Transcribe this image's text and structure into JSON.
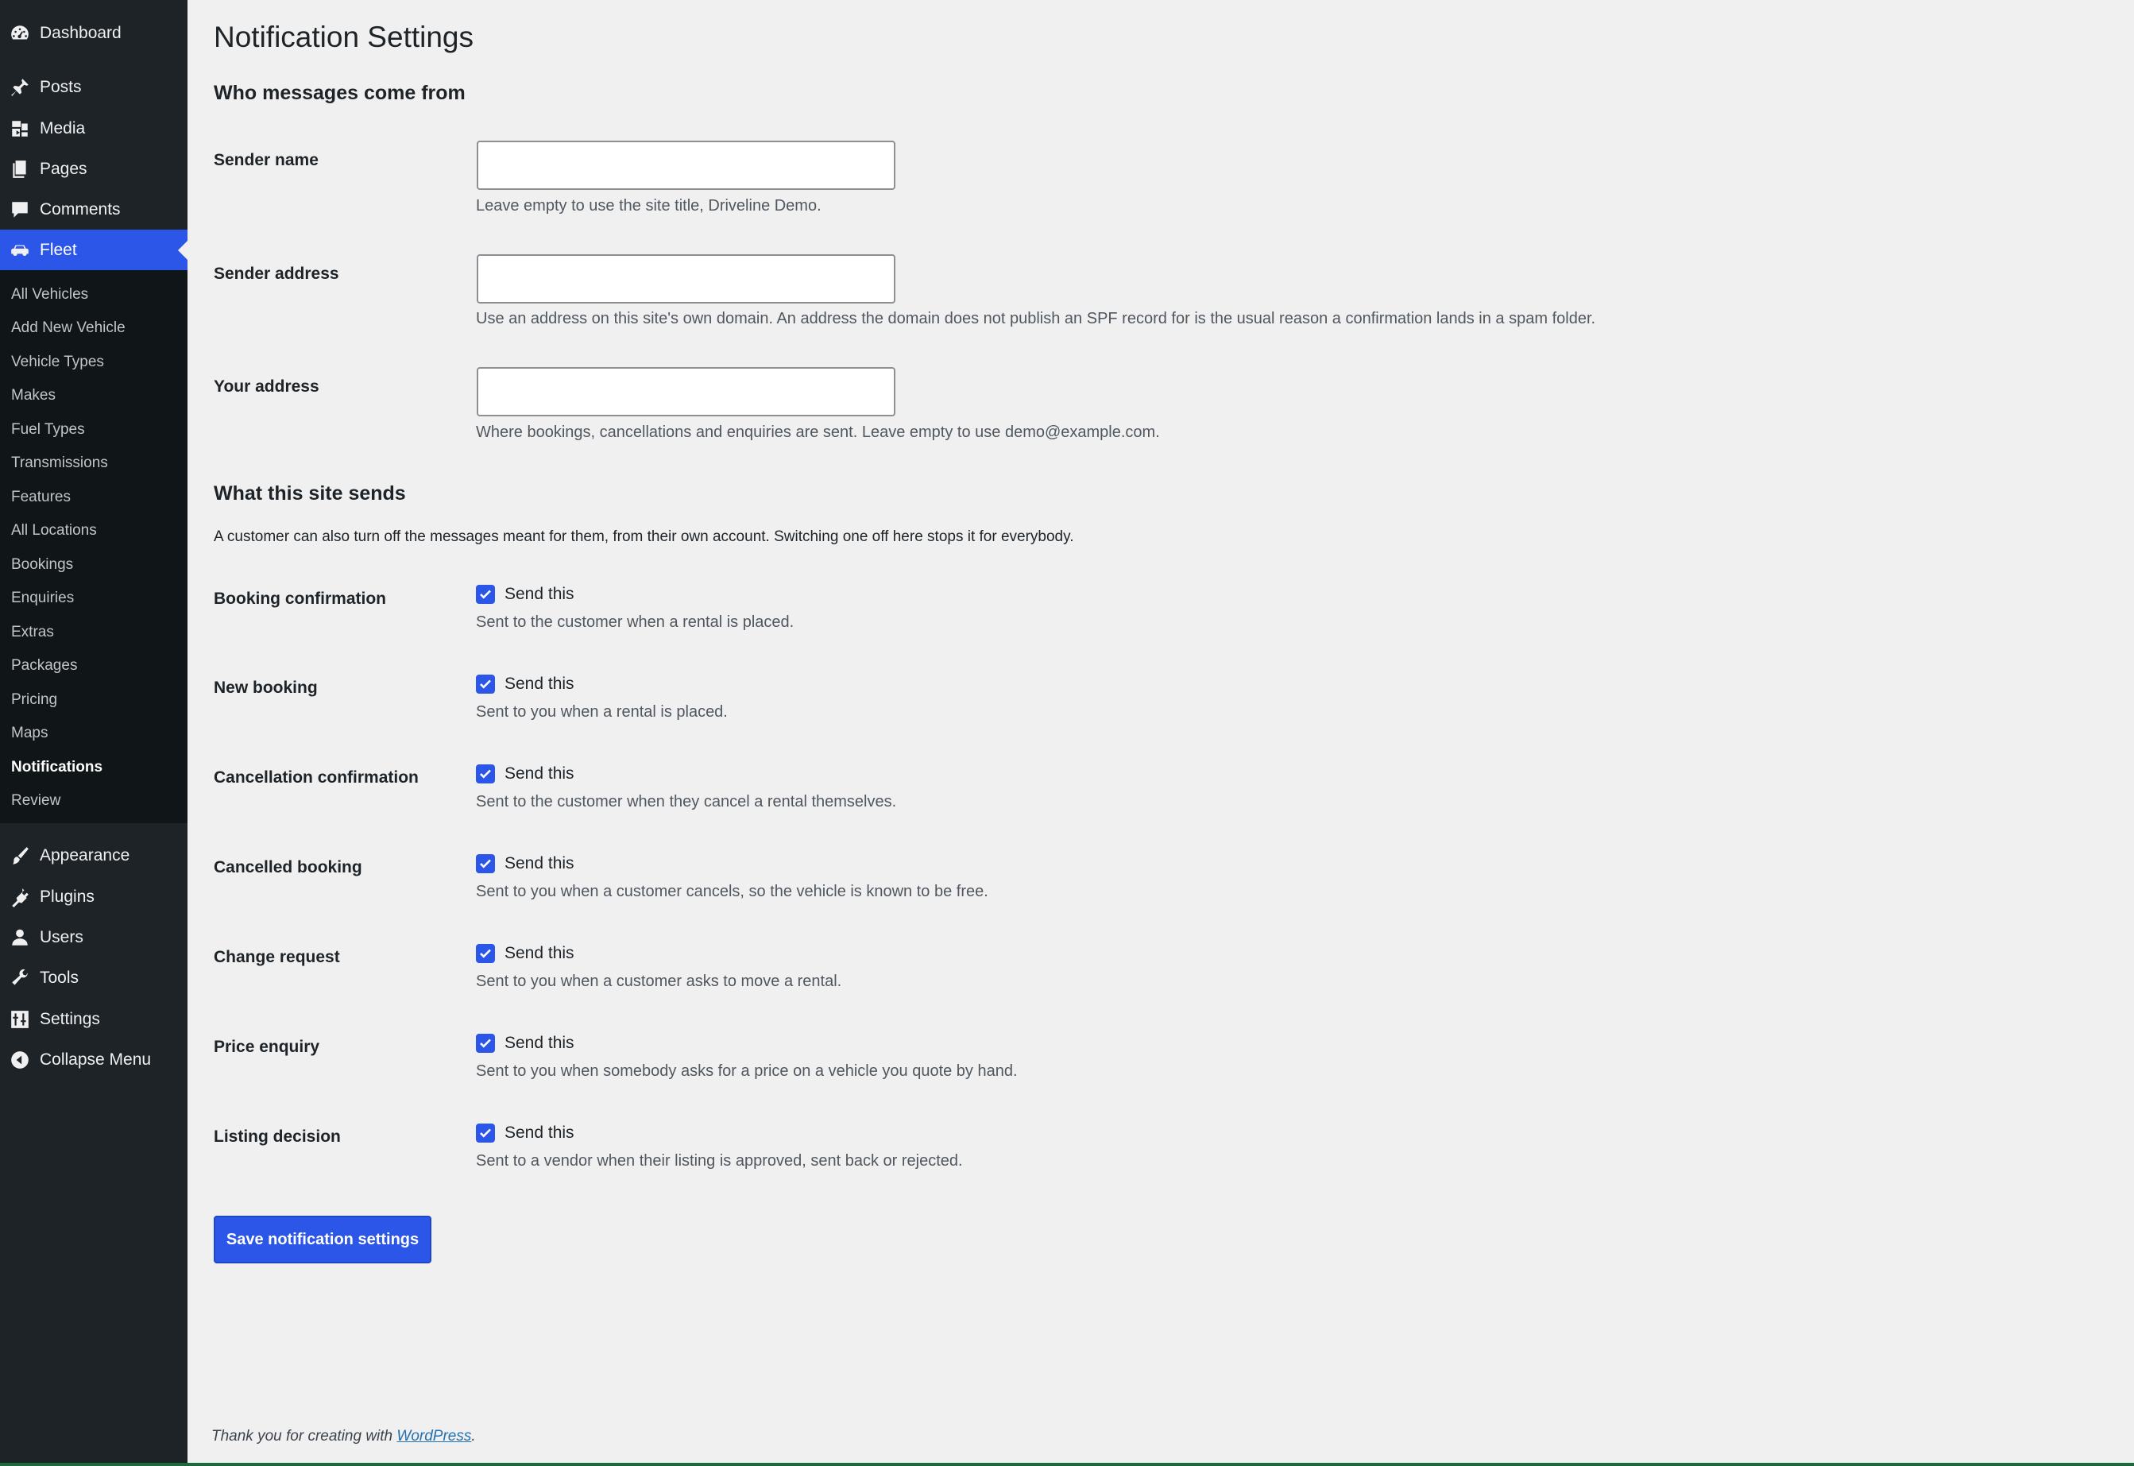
{
  "sidebar": {
    "top": [
      {
        "label": "Dashboard",
        "icon": "dashboard-icon"
      }
    ],
    "items": [
      {
        "label": "Posts",
        "icon": "pin-icon"
      },
      {
        "label": "Media",
        "icon": "media-icon"
      },
      {
        "label": "Pages",
        "icon": "pages-icon"
      },
      {
        "label": "Comments",
        "icon": "comment-icon"
      },
      {
        "label": "Fleet",
        "icon": "car-icon",
        "active": true
      }
    ],
    "submenu": [
      "All Vehicles",
      "Add New Vehicle",
      "Vehicle Types",
      "Makes",
      "Fuel Types",
      "Transmissions",
      "Features",
      "All Locations",
      "Bookings",
      "Enquiries",
      "Extras",
      "Packages",
      "Pricing",
      "Maps",
      "Notifications",
      "Review"
    ],
    "submenu_current": "Notifications",
    "bottom": [
      {
        "label": "Appearance",
        "icon": "brush-icon"
      },
      {
        "label": "Plugins",
        "icon": "plug-icon"
      },
      {
        "label": "Users",
        "icon": "user-icon"
      },
      {
        "label": "Tools",
        "icon": "wrench-icon"
      },
      {
        "label": "Settings",
        "icon": "settings-icon"
      },
      {
        "label": "Collapse Menu",
        "icon": "collapse-icon"
      }
    ]
  },
  "page": {
    "title": "Notification Settings",
    "sender_section": {
      "title": "Who messages come from",
      "fields": [
        {
          "label": "Sender name",
          "value": "",
          "description": "Leave empty to use the site title, Driveline Demo."
        },
        {
          "label": "Sender address",
          "value": "",
          "description": "Use an address on this site's own domain. An address the domain does not publish an SPF record for is the usual reason a confirmation lands in a spam folder."
        },
        {
          "label": "Your address",
          "value": "",
          "description": "Where bookings, cancellations and enquiries are sent. Leave empty to use demo@example.com."
        }
      ]
    },
    "sends_section": {
      "title": "What this site sends",
      "intro": "A customer can also turn off the messages meant for them, from their own account. Switching one off here stops it for everybody.",
      "checkbox_label": "Send this",
      "items": [
        {
          "label": "Booking confirmation",
          "checked": true,
          "description": "Sent to the customer when a rental is placed."
        },
        {
          "label": "New booking",
          "checked": true,
          "description": "Sent to you when a rental is placed."
        },
        {
          "label": "Cancellation confirmation",
          "checked": true,
          "description": "Sent to the customer when they cancel a rental themselves."
        },
        {
          "label": "Cancelled booking",
          "checked": true,
          "description": "Sent to you when a customer cancels, so the vehicle is known to be free."
        },
        {
          "label": "Change request",
          "checked": true,
          "description": "Sent to you when a customer asks to move a rental."
        },
        {
          "label": "Price enquiry",
          "checked": true,
          "description": "Sent to you when somebody asks for a price on a vehicle you quote by hand."
        },
        {
          "label": "Listing decision",
          "checked": true,
          "description": "Sent to a vendor when their listing is approved, sent back or rejected."
        }
      ]
    },
    "save_label": "Save notification settings"
  },
  "footer": {
    "text": "Thank you for creating with ",
    "link": "WordPress",
    "suffix": "."
  },
  "colors": {
    "accent": "#2c56e8",
    "sidebar_bg": "#1d2327",
    "submenu_bg": "#101517",
    "page_bg": "#f0f0f1"
  }
}
